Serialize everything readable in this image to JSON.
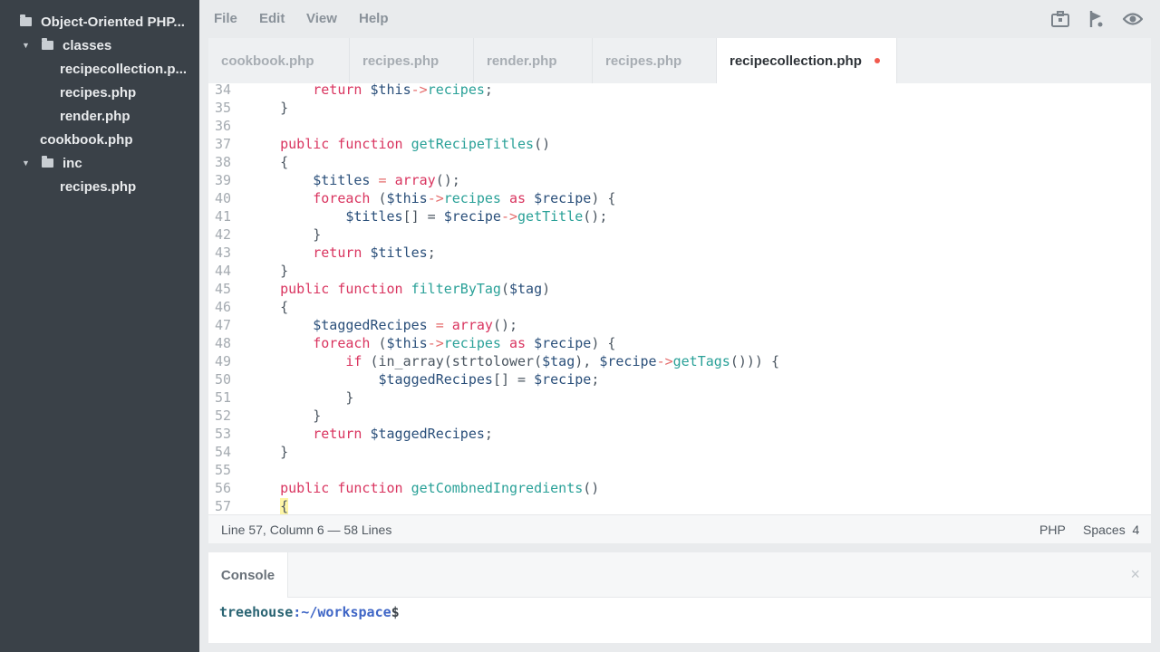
{
  "sidebar": {
    "items": [
      {
        "label": "Object-Oriented PHP..."
      },
      {
        "label": "classes"
      },
      {
        "label": "recipecollection.p..."
      },
      {
        "label": "recipes.php"
      },
      {
        "label": "render.php"
      },
      {
        "label": "cookbook.php"
      },
      {
        "label": "inc"
      },
      {
        "label": "recipes.php"
      }
    ]
  },
  "menu": {
    "file": "File",
    "edit": "Edit",
    "view": "View",
    "help": "Help"
  },
  "icons": {
    "share": "share-icon",
    "flag": "flag-icon",
    "preview": "eye-icon"
  },
  "tabs": [
    {
      "label": "cookbook.php"
    },
    {
      "label": "recipes.php"
    },
    {
      "label": "render.php"
    },
    {
      "label": "recipes.php"
    },
    {
      "label": "recipecollection.php"
    }
  ],
  "editor": {
    "lines": [
      {
        "n": "34",
        "tokens": [
          [
            "pl",
            "        "
          ],
          [
            "kw",
            "return "
          ],
          [
            "var",
            "$this"
          ],
          [
            "op",
            "->"
          ],
          [
            "fn",
            "recipes"
          ],
          [
            "pl",
            ";"
          ]
        ]
      },
      {
        "n": "35",
        "tokens": [
          [
            "pl",
            "    }"
          ]
        ]
      },
      {
        "n": "36",
        "tokens": []
      },
      {
        "n": "37",
        "tokens": [
          [
            "pl",
            "    "
          ],
          [
            "kw",
            "public function "
          ],
          [
            "fn",
            "getRecipeTitles"
          ],
          [
            "pl",
            "()"
          ]
        ]
      },
      {
        "n": "38",
        "tokens": [
          [
            "pl",
            "    {"
          ]
        ]
      },
      {
        "n": "39",
        "tokens": [
          [
            "pl",
            "        "
          ],
          [
            "var",
            "$titles "
          ],
          [
            "op",
            "= "
          ],
          [
            "kw",
            "array"
          ],
          [
            "pl",
            "();"
          ]
        ]
      },
      {
        "n": "40",
        "tokens": [
          [
            "pl",
            "        "
          ],
          [
            "kw",
            "foreach "
          ],
          [
            "pl",
            "("
          ],
          [
            "var",
            "$this"
          ],
          [
            "op",
            "->"
          ],
          [
            "fn",
            "recipes "
          ],
          [
            "kw",
            "as "
          ],
          [
            "var",
            "$recipe"
          ],
          [
            "pl",
            ") {"
          ]
        ]
      },
      {
        "n": "41",
        "tokens": [
          [
            "pl",
            "            "
          ],
          [
            "var",
            "$titles"
          ],
          [
            "pl",
            "[] = "
          ],
          [
            "var",
            "$recipe"
          ],
          [
            "op",
            "->"
          ],
          [
            "fn",
            "getTitle"
          ],
          [
            "pl",
            "();"
          ]
        ]
      },
      {
        "n": "42",
        "tokens": [
          [
            "pl",
            "        }"
          ]
        ]
      },
      {
        "n": "43",
        "tokens": [
          [
            "pl",
            "        "
          ],
          [
            "kw",
            "return "
          ],
          [
            "var",
            "$titles"
          ],
          [
            "pl",
            ";"
          ]
        ]
      },
      {
        "n": "44",
        "tokens": [
          [
            "pl",
            "    }"
          ]
        ]
      },
      {
        "n": "45",
        "tokens": [
          [
            "pl",
            "    "
          ],
          [
            "kw",
            "public function "
          ],
          [
            "fn",
            "filterByTag"
          ],
          [
            "pl",
            "("
          ],
          [
            "var",
            "$tag"
          ],
          [
            "pl",
            ")"
          ]
        ]
      },
      {
        "n": "46",
        "tokens": [
          [
            "pl",
            "    {"
          ]
        ]
      },
      {
        "n": "47",
        "tokens": [
          [
            "pl",
            "        "
          ],
          [
            "var",
            "$taggedRecipes "
          ],
          [
            "op",
            "= "
          ],
          [
            "kw",
            "array"
          ],
          [
            "pl",
            "();"
          ]
        ]
      },
      {
        "n": "48",
        "tokens": [
          [
            "pl",
            "        "
          ],
          [
            "kw",
            "foreach "
          ],
          [
            "pl",
            "("
          ],
          [
            "var",
            "$this"
          ],
          [
            "op",
            "->"
          ],
          [
            "fn",
            "recipes "
          ],
          [
            "kw",
            "as "
          ],
          [
            "var",
            "$recipe"
          ],
          [
            "pl",
            ") {"
          ]
        ]
      },
      {
        "n": "49",
        "tokens": [
          [
            "pl",
            "            "
          ],
          [
            "kw",
            "if "
          ],
          [
            "pl",
            "(in_array(strtolower("
          ],
          [
            "var",
            "$tag"
          ],
          [
            "pl",
            "), "
          ],
          [
            "var",
            "$recipe"
          ],
          [
            "op",
            "->"
          ],
          [
            "fn",
            "getTags"
          ],
          [
            "pl",
            "())) {"
          ]
        ]
      },
      {
        "n": "50",
        "tokens": [
          [
            "pl",
            "                "
          ],
          [
            "var",
            "$taggedRecipes"
          ],
          [
            "pl",
            "[] = "
          ],
          [
            "var",
            "$recipe"
          ],
          [
            "pl",
            ";"
          ]
        ]
      },
      {
        "n": "51",
        "tokens": [
          [
            "pl",
            "            }"
          ]
        ]
      },
      {
        "n": "52",
        "tokens": [
          [
            "pl",
            "        }"
          ]
        ]
      },
      {
        "n": "53",
        "tokens": [
          [
            "pl",
            "        "
          ],
          [
            "kw",
            "return "
          ],
          [
            "var",
            "$taggedRecipes"
          ],
          [
            "pl",
            ";"
          ]
        ]
      },
      {
        "n": "54",
        "tokens": [
          [
            "pl",
            "    }"
          ]
        ]
      },
      {
        "n": "55",
        "tokens": []
      },
      {
        "n": "56",
        "tokens": [
          [
            "pl",
            "    "
          ],
          [
            "kw",
            "public function "
          ],
          [
            "fn",
            "getCombnedIngredients"
          ],
          [
            "pl",
            "()"
          ]
        ]
      },
      {
        "n": "57",
        "tokens": [
          [
            "pl",
            "    "
          ],
          [
            "hl",
            "{"
          ]
        ]
      }
    ]
  },
  "status": {
    "position": "Line 57, Column 6 — 58 Lines",
    "language": "PHP",
    "indent_label": "Spaces",
    "indent_size": "4"
  },
  "console": {
    "tab_label": "Console",
    "close": "×",
    "prompt_user": "treehouse",
    "prompt_path": ":~/workspace",
    "prompt_sign": "$"
  },
  "colors": {
    "sidebar_bg": "#3a4148",
    "keyword": "#d9345f",
    "function": "#2aa198",
    "variable": "#2a4f7a",
    "unsaved_dot": "#f15a4e"
  }
}
